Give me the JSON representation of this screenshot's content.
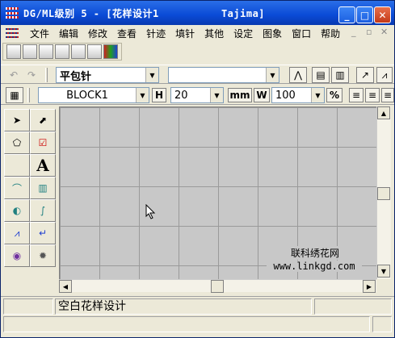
{
  "window": {
    "title": "DG/ML级别 5 - [花样设计1          Tajima]"
  },
  "menu": [
    "文件",
    "编辑",
    "修改",
    "查看",
    "针迹",
    "填针",
    "其他",
    "设定",
    "图象",
    "窗口",
    "帮助"
  ],
  "toolbar": {
    "stitch_type": "平包针",
    "stitch_secondary": "",
    "font_name": "BLOCK1",
    "height_label": "H",
    "height_value": "20",
    "unit_label": "mm",
    "width_label": "W",
    "width_value": "100",
    "percent_label": "%"
  },
  "watermark": {
    "line1": "联科绣花网",
    "line2": "www.linkgd.com"
  },
  "status": {
    "message": "空白花样设计"
  },
  "colors": {
    "titlebar": "#0a4ad6",
    "canvas": "#c8c8c8",
    "grid": "#9a9a9a"
  }
}
